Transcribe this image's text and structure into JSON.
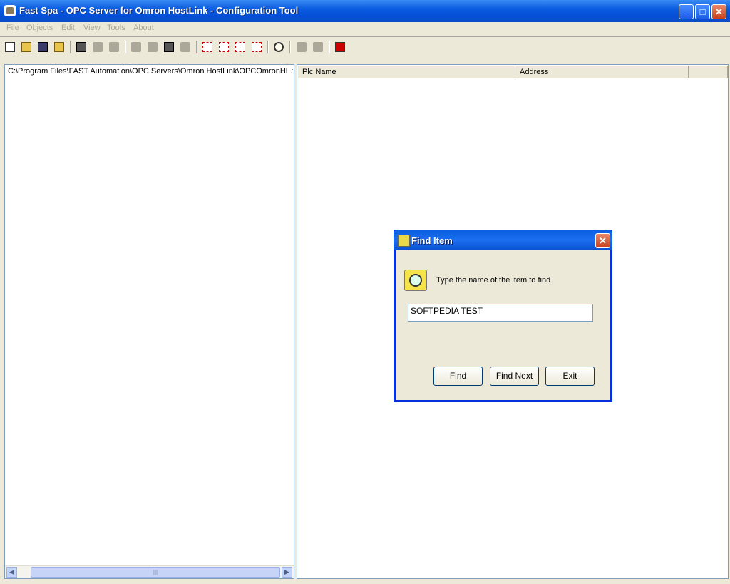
{
  "window": {
    "title": "Fast Spa - OPC Server for Omron HostLink - Configuration Tool",
    "minimize_label": "_",
    "maximize_label": "□",
    "close_label": "✕"
  },
  "menu": [
    "File",
    "Objects",
    "Edit",
    "View",
    "Tools",
    "About"
  ],
  "toolbar": {
    "icons": [
      "new-icon",
      "open-icon",
      "save-icon",
      "open-folder-icon",
      "new-device-icon",
      "new-group-icon",
      "new-tag-icon",
      "copy-icon",
      "cut-icon",
      "paste-icon",
      "delete-icon",
      "red-item-icon-1",
      "red-item-icon-2",
      "red-item-icon-3",
      "red-list-icon",
      "find-icon",
      "import-icon",
      "export-icon",
      "exit-icon"
    ]
  },
  "tree": {
    "root_path": "C:\\Program Files\\FAST Automation\\OPC Servers\\Omron HostLink\\OPCOmronHL.xml"
  },
  "list": {
    "columns": [
      "Plc Name",
      "Address"
    ]
  },
  "scrollbar": {
    "left_arrow": "◀",
    "right_arrow": "▶",
    "thumb_grip": "|||"
  },
  "find_dialog": {
    "title": "Find Item",
    "close_label": "✕",
    "prompt": "Type the name of the item to find",
    "input_value": "SOFTPEDIA TEST",
    "buttons": {
      "find": "Find",
      "find_next": "Find Next",
      "exit": "Exit"
    }
  }
}
